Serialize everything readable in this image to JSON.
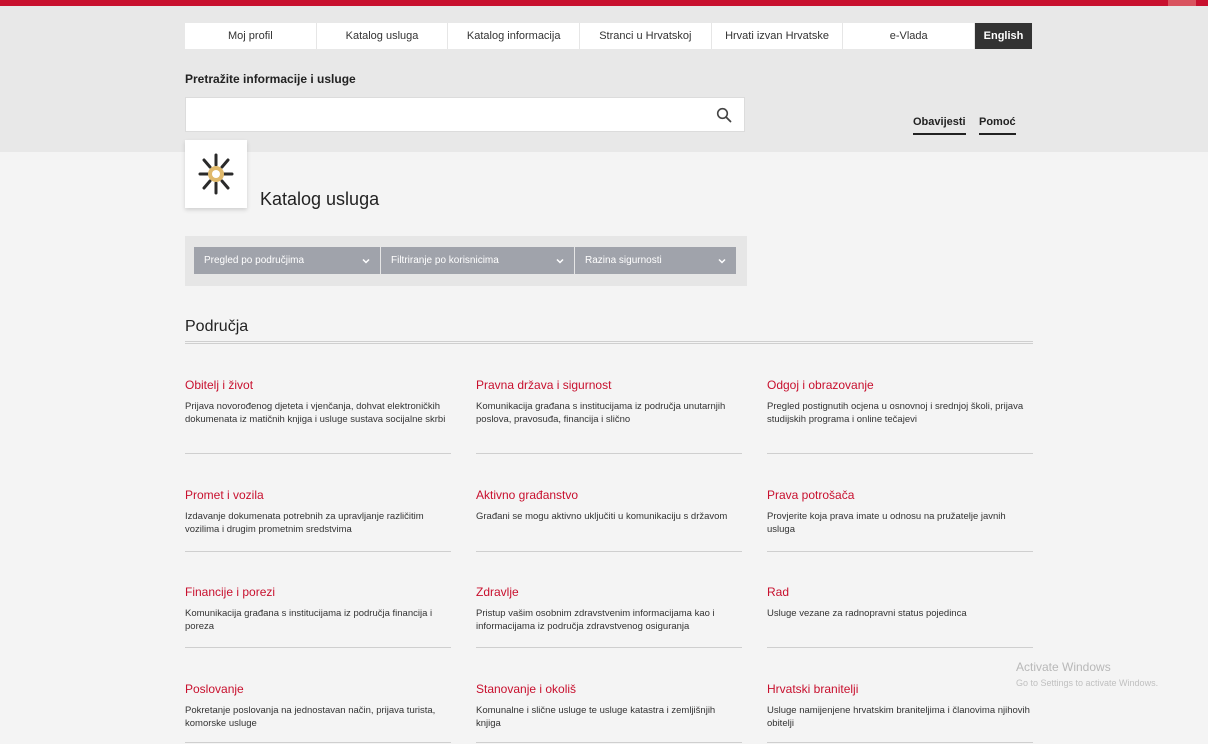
{
  "nav": {
    "items": [
      {
        "label": "Moj profil"
      },
      {
        "label": "Katalog usluga"
      },
      {
        "label": "Katalog informacija"
      },
      {
        "label": "Stranci u Hrvatskoj"
      },
      {
        "label": "Hrvati izvan Hrvatske"
      },
      {
        "label": "e-Vlada"
      },
      {
        "label": "English"
      }
    ]
  },
  "search": {
    "label": "Pretražite informacije i usluge",
    "value": "",
    "placeholder": ""
  },
  "util": {
    "notices": "Obavijesti",
    "help": "Pomoć"
  },
  "page": {
    "title": "Katalog usluga"
  },
  "filters": [
    {
      "label": "Pregled po područjima"
    },
    {
      "label": "Filtriranje po korisnicima"
    },
    {
      "label": "Razina sigurnosti"
    }
  ],
  "section": {
    "title": "Područja"
  },
  "areas": [
    {
      "title": "Obitelj i život",
      "desc": "Prijava novorođenog djeteta i vjenčanja, dohvat elektroničkih dokumenata iz matičnih knjiga i usluge sustava socijalne skrbi"
    },
    {
      "title": "Pravna država i sigurnost",
      "desc": "Komunikacija građana s institucijama iz područja unutarnjih poslova, pravosuđa, financija i slično"
    },
    {
      "title": "Odgoj i obrazovanje",
      "desc": "Pregled postignutih ocjena u osnovnoj i srednjoj školi, prijava studijskih programa i online tečajevi"
    },
    {
      "title": "Promet i vozila",
      "desc": "Izdavanje dokumenata potrebnih za upravljanje različitim vozilima i drugim prometnim sredstvima"
    },
    {
      "title": "Aktivno građanstvo",
      "desc": "Građani se mogu aktivno uključiti u komunikaciju s državom"
    },
    {
      "title": "Prava potrošača",
      "desc": "Provjerite koja prava imate u odnosu na pružatelje javnih usluga"
    },
    {
      "title": "Financije i porezi",
      "desc": "Komunikacija građana s institucijama iz područja financija i poreza"
    },
    {
      "title": "Zdravlje",
      "desc": "Pristup vašim osobnim zdravstvenim informacijama kao i informacijama iz područja zdravstvenog osiguranja"
    },
    {
      "title": "Rad",
      "desc": "Usluge vezane za radnopravni status pojedinca"
    },
    {
      "title": "Poslovanje",
      "desc": "Pokretanje poslovanja na jednostavan način, prijava turista, komorske usluge"
    },
    {
      "title": "Stanovanje i okoliš",
      "desc": "Komunalne i slične usluge te usluge katastra i zemljišnjih knjiga"
    },
    {
      "title": "Hrvatski branitelji",
      "desc": "Usluge namijenjene hrvatskim braniteljima i članovima njihovih obitelji"
    }
  ],
  "watermark": {
    "line1": "Activate Windows",
    "line2": "Go to Settings to activate Windows."
  },
  "colors": {
    "accent": "#c8102e",
    "filter_bg": "#a0a3ab"
  }
}
